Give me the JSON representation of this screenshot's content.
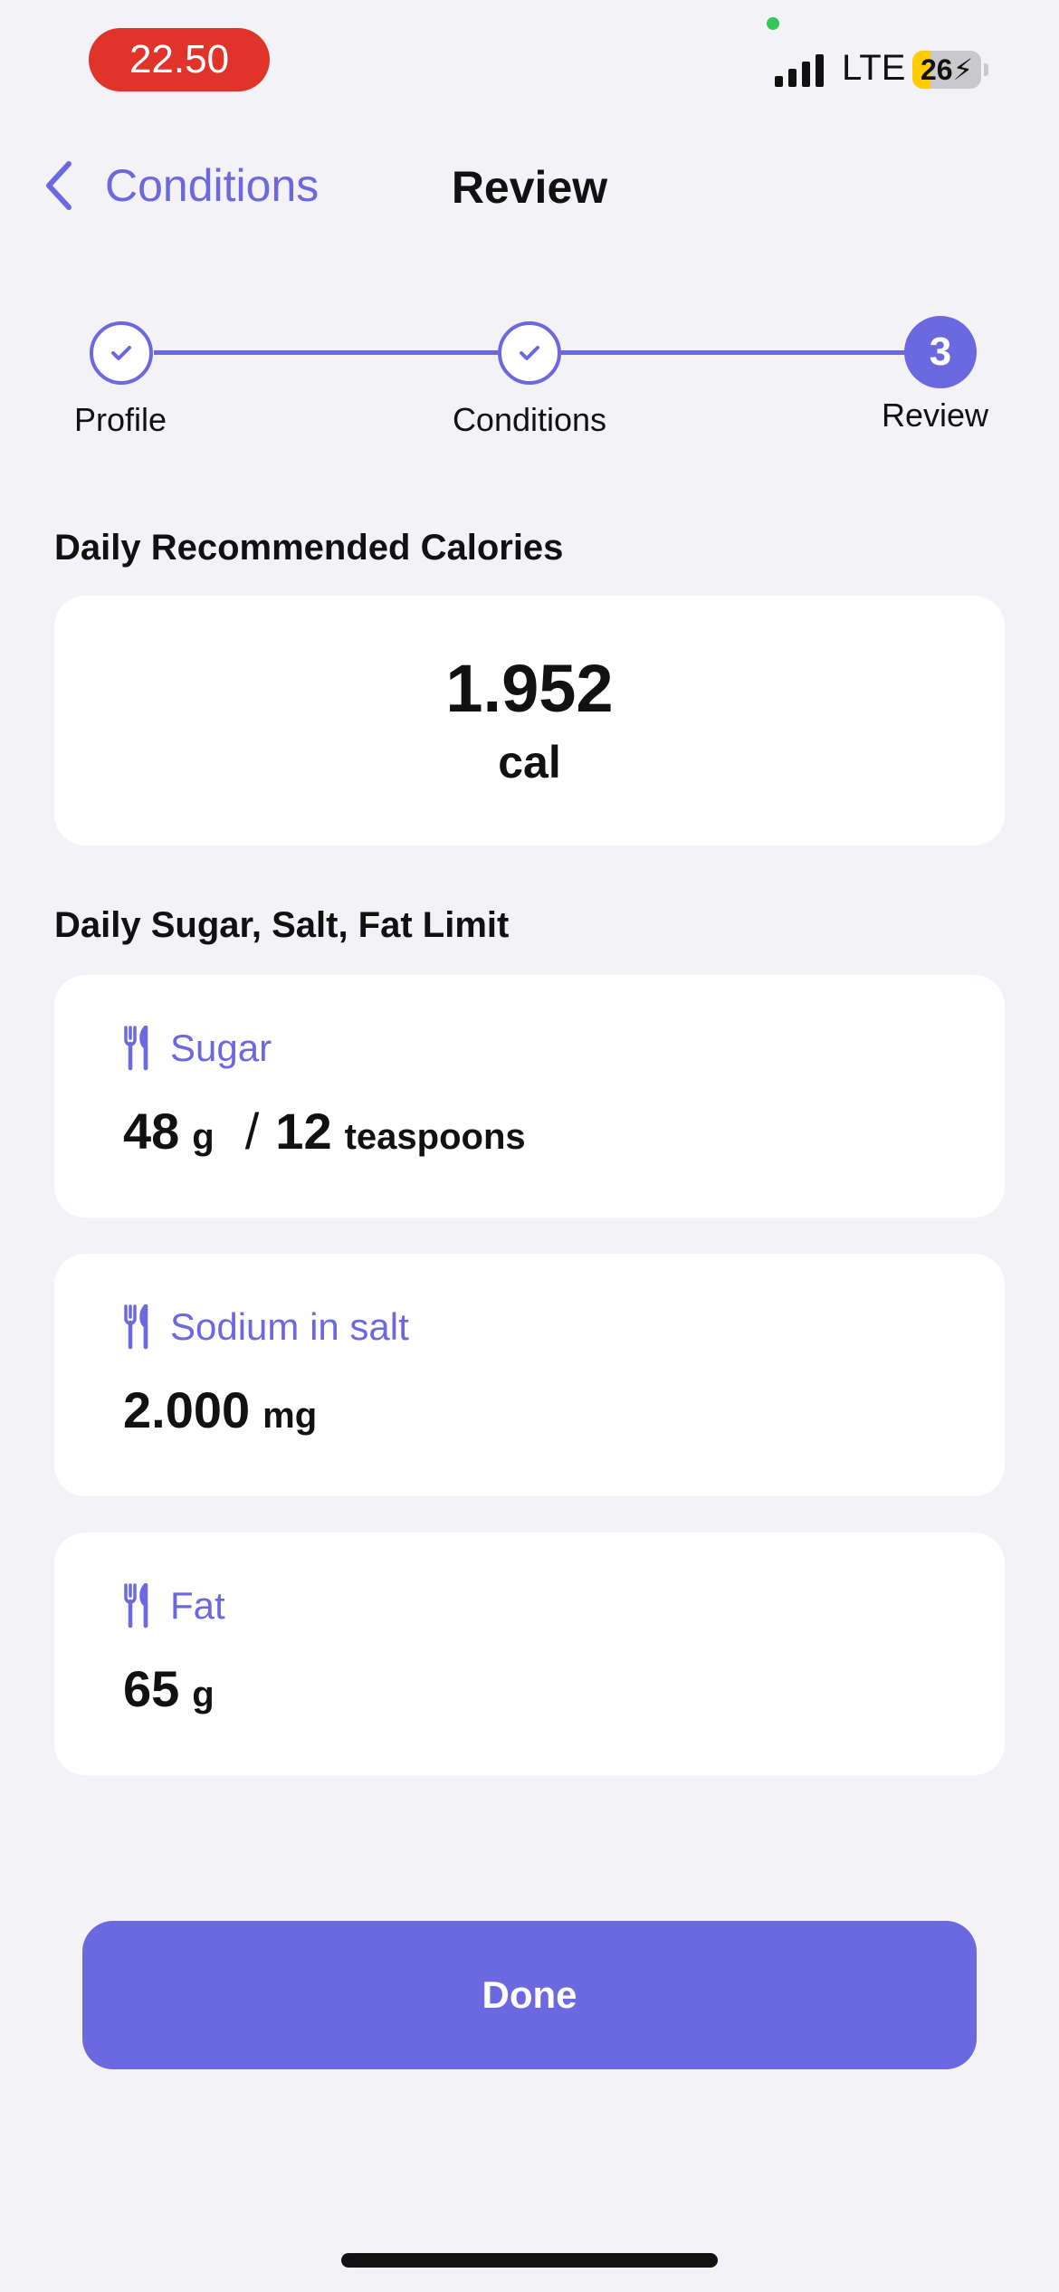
{
  "status_bar": {
    "time": "22.50",
    "network": "LTE",
    "battery_percent": "26",
    "battery_level": 0.26,
    "battery_color": "#ffcc00",
    "time_pill_color": "#e0342b"
  },
  "nav": {
    "back_label": "Conditions",
    "title": "Review"
  },
  "stepper": {
    "steps": [
      {
        "label": "Profile",
        "state": "completed"
      },
      {
        "label": "Conditions",
        "state": "completed"
      },
      {
        "label": "Review",
        "state": "active",
        "number": "3"
      }
    ],
    "accent_color": "#6c68e0"
  },
  "calories": {
    "section_title": "Daily Recommended Calories",
    "value": "1.952",
    "unit": "cal"
  },
  "limits": {
    "section_title": "Daily Sugar, Salt, Fat Limit",
    "items": [
      {
        "name": "Sugar",
        "icon": "fork-knife-icon",
        "value": "48",
        "unit": "g",
        "alt_value": "12",
        "alt_unit": "teaspoons"
      },
      {
        "name": "Sodium in salt",
        "icon": "fork-knife-icon",
        "value": "2.000",
        "unit": "mg"
      },
      {
        "name": "Fat",
        "icon": "fork-knife-icon",
        "value": "65",
        "unit": "g"
      }
    ]
  },
  "done_label": "Done"
}
